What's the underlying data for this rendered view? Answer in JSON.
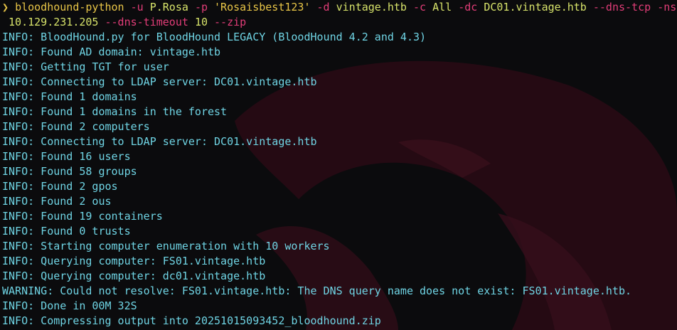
{
  "command": {
    "prompt_symbol": "❯",
    "executable": "bloodhound-python",
    "tokens_line1": [
      {
        "t": "flag",
        "v": "-u"
      },
      {
        "t": "arg",
        "v": "P.Rosa"
      },
      {
        "t": "flag",
        "v": "-p"
      },
      {
        "t": "str",
        "v": "'Rosaisbest123'"
      },
      {
        "t": "flag",
        "v": "-d"
      },
      {
        "t": "arg",
        "v": "vintage.htb"
      },
      {
        "t": "flag",
        "v": "-c"
      },
      {
        "t": "arg",
        "v": "All"
      },
      {
        "t": "flag",
        "v": "-dc"
      },
      {
        "t": "arg",
        "v": "DC01.vintage.htb"
      },
      {
        "t": "flag",
        "v": "--dns-tcp"
      },
      {
        "t": "flag",
        "v": "-ns"
      }
    ],
    "tokens_line2": [
      {
        "t": "arg",
        "v": "10.129.231.205"
      },
      {
        "t": "flag",
        "v": "--dns-timeout"
      },
      {
        "t": "arg",
        "v": "10"
      },
      {
        "t": "flag",
        "v": "--zip"
      }
    ]
  },
  "output": [
    "INFO: BloodHound.py for BloodHound LEGACY (BloodHound 4.2 and 4.3)",
    "INFO: Found AD domain: vintage.htb",
    "INFO: Getting TGT for user",
    "INFO: Connecting to LDAP server: DC01.vintage.htb",
    "INFO: Found 1 domains",
    "INFO: Found 1 domains in the forest",
    "INFO: Found 2 computers",
    "INFO: Connecting to LDAP server: DC01.vintage.htb",
    "INFO: Found 16 users",
    "INFO: Found 58 groups",
    "INFO: Found 2 gpos",
    "INFO: Found 2 ous",
    "INFO: Found 19 containers",
    "INFO: Found 0 trusts",
    "INFO: Starting computer enumeration with 10 workers",
    "INFO: Querying computer: FS01.vintage.htb",
    "INFO: Querying computer: dc01.vintage.htb",
    "WARNING: Could not resolve: FS01.vintage.htb: The DNS query name does not exist: FS01.vintage.htb.",
    "INFO: Done in 00M 32S",
    "INFO: Compressing output into 20251015093452_bloodhound.zip"
  ],
  "colors": {
    "background": "#0b0b0d",
    "output_text": "#6fd4e4",
    "prompt": "#e8c547",
    "flag": "#e23d78",
    "arg": "#d7e36a",
    "bg_art": "#3a0f1c"
  }
}
